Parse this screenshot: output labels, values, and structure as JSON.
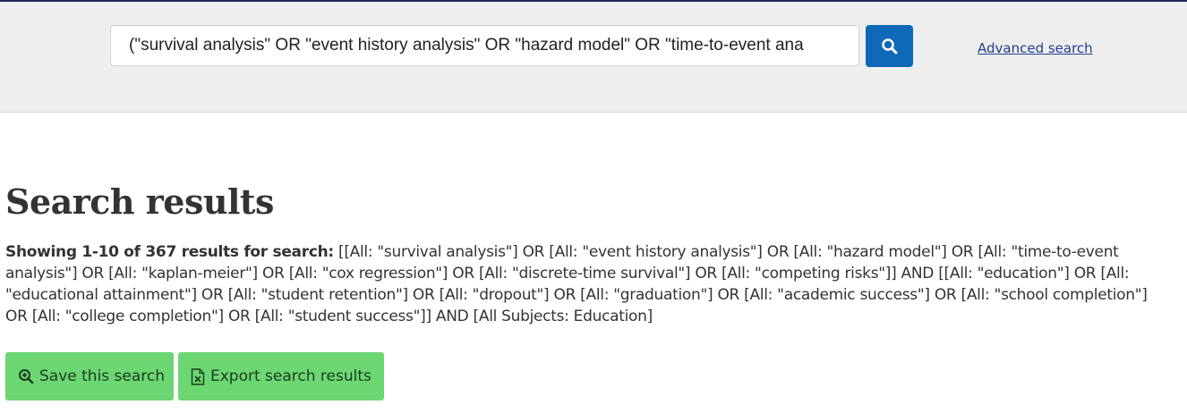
{
  "search": {
    "value": "(\"survival analysis\" OR \"event history analysis\" OR \"hazard model\" OR \"time-to-event ana",
    "button_icon": "search-icon",
    "advanced_label": "Advanced search"
  },
  "main": {
    "title": "Search results",
    "summary_count": "Showing 1-10 of 367 results for search:",
    "summary_query": "[[All: \"survival analysis\"] OR [All: \"event history analysis\"] OR [All: \"hazard model\"] OR [All: \"time-to-event analysis\"] OR [All: \"kaplan-meier\"] OR [All: \"cox regression\"] OR [All: \"discrete-time survival\"] OR [All: \"competing risks\"]] AND [[All: \"education\"] OR [All: \"educational attainment\"] OR [All: \"student retention\"] OR [All: \"dropout\"] OR [All: \"graduation\"] OR [All: \"academic success\"] OR [All: \"school completion\"] OR [All: \"college completion\"] OR [All: \"student success\"]] AND [All Subjects: Education]"
  },
  "actions": {
    "save_label": "Save this search",
    "save_icon": "zoom-plus-icon",
    "export_label": "Export search results",
    "export_icon": "spreadsheet-file-icon"
  },
  "colors": {
    "top_border": "#1f2a5a",
    "search_band": "#eeeeee",
    "search_button": "#0e6ab8",
    "link": "#23408e",
    "action_button": "#6bd672"
  }
}
